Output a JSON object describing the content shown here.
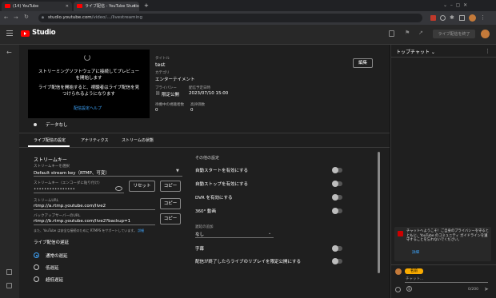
{
  "browser": {
    "tabs": [
      {
        "label": "(14) YouTube"
      },
      {
        "label": "ライブ配信 - YouTube Studio"
      }
    ],
    "new_tab": "+",
    "url_main": "studio.youtube.com",
    "url_rest": "/video/.../livestreaming",
    "nav_back": "←",
    "nav_forward": "→",
    "nav_reload": "↻"
  },
  "studio": {
    "logo": "Studio",
    "end_stream": "ライブ配信を終了"
  },
  "preview": {
    "line1": "ストリーミングソフトウェアに接続してプレビューを開始します",
    "line2": "ライブ配信を開始すると、視聴者はライブ配信を見つけられるようになります",
    "help": "配信設定ヘルプ",
    "no_data": "データなし"
  },
  "info": {
    "title_label": "タイトル",
    "title": "test",
    "category_label": "カテゴリ",
    "category": "エンターテイメント",
    "privacy_label": "プライバシー",
    "privacy": "限定公開",
    "scheduled_label": "配信予定日時",
    "scheduled": "2023/07/10 15:00",
    "viewers_label": "待機中の視聴者数",
    "viewers": "0",
    "likes_label": "高評価数",
    "likes": "0",
    "edit": "編集"
  },
  "tabs": [
    {
      "label": "ライブ配信の設定"
    },
    {
      "label": "アナリティクス"
    },
    {
      "label": "ストリームの状態"
    }
  ],
  "stream": {
    "heading": "ストリームキー",
    "key_select_label": "ストリームキーを選択",
    "key_select": "Default stream key（RTMP、可変）",
    "key_field_label": "ストリームキー（エンコーダに貼り付け）",
    "key_value": "••••••••••••••••",
    "reset": "リセット",
    "copy": "コピー",
    "url_label": "ストリームURL",
    "url": "rtmp://a.rtmp.youtube.com/live2",
    "backup_label": "バックアップサーバーのURL",
    "backup": "rtmp://b.rtmp.youtube.com/live2?backup=1",
    "note": "また、YouTube は安全な接続のために RTMPS をサポートしています。",
    "note_link": "詳細",
    "latency_heading": "ライブ配信の遅延",
    "latency": [
      {
        "label": "通常の遅延"
      },
      {
        "label": "低遅延"
      },
      {
        "label": "超低遅延"
      }
    ]
  },
  "other": {
    "heading": "その他の設定",
    "items": [
      {
        "label": "自動スタートを有効にする"
      },
      {
        "label": "自動ストップを有効にする"
      },
      {
        "label": "DVR を有効にする"
      },
      {
        "label": "360° 動画"
      }
    ],
    "delay_label": "遅延の追加",
    "delay": "なし",
    "items2": [
      {
        "label": "字幕"
      },
      {
        "label": "配信が終了したらライブのリプレイを限定公開にする"
      }
    ]
  },
  "chat": {
    "title": "トップチャット",
    "notice": "チャットへようこそ！ご自身のプライバシーを守るとともに、YouTube のコミュニティ ガイドラインを遵守することを忘れないでください。",
    "notice_link": "詳細",
    "input_placeholder": "チャット...",
    "counter": "0/200",
    "user_badge": "名前"
  }
}
